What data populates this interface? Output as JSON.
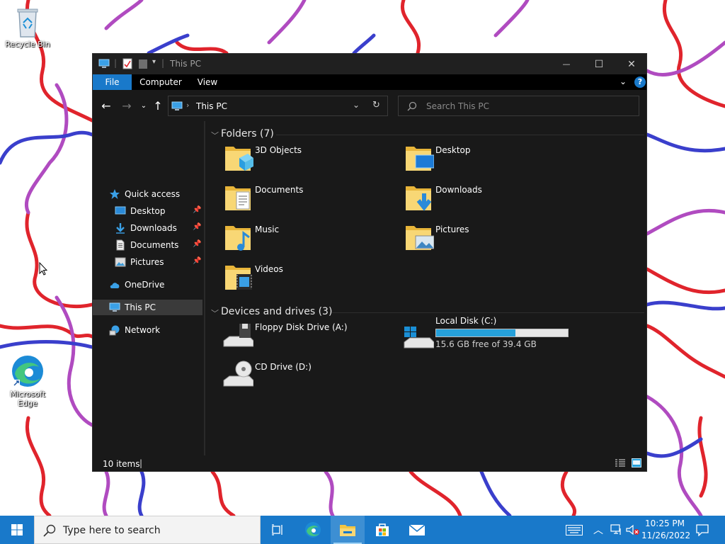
{
  "desktop": {
    "icons": [
      {
        "label": "Recycle Bin",
        "icon": "recycle-bin-icon"
      },
      {
        "label": "Microsoft Edge",
        "icon": "edge-icon"
      }
    ]
  },
  "window": {
    "title": "This PC",
    "controls": {
      "minimize": "—",
      "maximize": "☐",
      "close": "✕"
    }
  },
  "ribbon": {
    "tabs": [
      "File",
      "Computer",
      "View"
    ],
    "active_color": "#1979ca"
  },
  "address": {
    "path": "This PC",
    "search_placeholder": "Search This PC"
  },
  "nav": {
    "quick_access": "Quick access",
    "quick_items": [
      "Desktop",
      "Downloads",
      "Documents",
      "Pictures"
    ],
    "onedrive": "OneDrive",
    "this_pc": "This PC",
    "network": "Network"
  },
  "content": {
    "folders_header": "Folders (7)",
    "folders": [
      "3D Objects",
      "Desktop",
      "Documents",
      "Downloads",
      "Music",
      "Pictures",
      "Videos"
    ],
    "devices_header": "Devices and drives (3)",
    "devices": [
      {
        "name": "Floppy Disk Drive (A:)"
      },
      {
        "name": "Local Disk (C:)",
        "free": "15.6 GB free of 39.4 GB",
        "used_fraction": 0.604
      },
      {
        "name": "CD Drive (D:)"
      }
    ]
  },
  "status": {
    "items": "10 items"
  },
  "taskbar": {
    "search_placeholder": "Type here to search",
    "time": "10:25 PM",
    "date": "11/26/2022"
  }
}
